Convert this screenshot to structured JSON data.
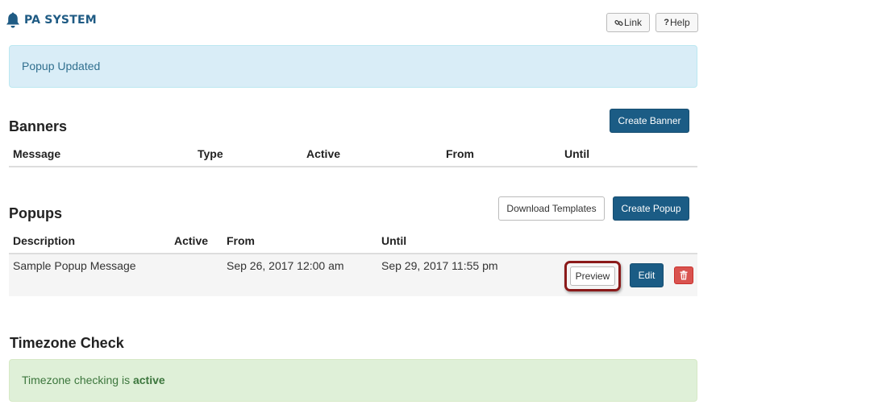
{
  "app": {
    "title": "PA SYSTEM"
  },
  "toolbar": {
    "link_label": "Link",
    "link_icon": "link-icon",
    "help_label": "Help",
    "help_icon": "question-icon"
  },
  "alert": {
    "message": "Popup Updated"
  },
  "banners": {
    "heading": "Banners",
    "create_label": "Create Banner",
    "columns": [
      "Message",
      "Type",
      "Active",
      "From",
      "Until"
    ]
  },
  "popups": {
    "heading": "Popups",
    "download_label": "Download Templates",
    "create_label": "Create Popup",
    "columns": [
      "Description",
      "Active",
      "From",
      "Until"
    ],
    "rows": [
      {
        "description": "Sample Popup Message",
        "active": "",
        "from": "Sep 26, 2017 12:00 am",
        "until": "Sep 29, 2017 11:55 pm",
        "preview_label": "Preview",
        "edit_label": "Edit",
        "delete_icon": "trash-icon"
      }
    ]
  },
  "timezone": {
    "heading": "Timezone Check",
    "message_prefix": "Timezone checking is",
    "status": "active"
  },
  "colors": {
    "brand": "#1b5c85",
    "info_bg": "#d9edf7",
    "success_bg": "#dff0d8",
    "danger": "#d9534f",
    "highlight_ring": "#8b1a1a"
  }
}
